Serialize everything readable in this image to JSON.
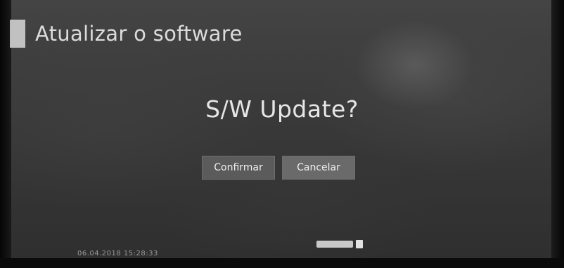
{
  "header": {
    "title": "Atualizar o software"
  },
  "dialog": {
    "question": "S/W Update?",
    "confirm_label": "Confirmar",
    "cancel_label": "Cancelar"
  },
  "status": {
    "datetime": "06.04.2018  15:28:33"
  },
  "colors": {
    "background": "#3a3a3a",
    "button": "#5b5b5b",
    "text": "#e6e6e6"
  }
}
